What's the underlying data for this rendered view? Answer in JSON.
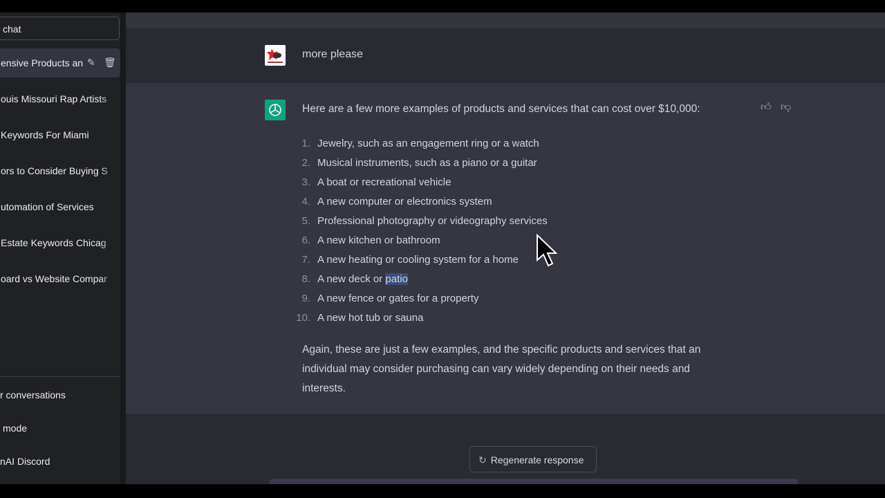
{
  "sidebar": {
    "new_chat": "chat",
    "conversations": [
      "ensive Products an",
      "ouis Missouri Rap Artists",
      "Keywords For Miami",
      "ors to Consider Buying S",
      "utomation of Services",
      "Estate Keywords Chicag",
      "oard vs Website Compar"
    ],
    "bottom": [
      "r conversations",
      "mode",
      "nAI Discord"
    ]
  },
  "chat": {
    "user_message": "more please",
    "assistant_intro": "Here are a few more examples of products and services that can cost over $10,000:",
    "items": [
      "Jewelry, such as an engagement ring or a watch",
      "Musical instruments, such as a piano or a guitar",
      "A boat or recreational vehicle",
      "A new computer or electronics system",
      "Professional photography or videography services",
      "A new kitchen or bathroom",
      "A new heating or cooling system for a home",
      "A new deck or ",
      "A new fence or gates for a property",
      "A new hot tub or sauna"
    ],
    "item8_highlight": "patio",
    "numbers": [
      "1.",
      "2.",
      "3.",
      "4.",
      "5.",
      "6.",
      "7.",
      "8.",
      "9.",
      "10."
    ],
    "closing": "Again, these are just a few examples, and the specific products and services that an individual may consider purchasing can vary widely depending on their needs and interests.",
    "regenerate": "Regenerate response"
  },
  "colors": {
    "openai_green": "#10a37f",
    "sidebar": "#202123",
    "assistant_bg": "#353640"
  }
}
